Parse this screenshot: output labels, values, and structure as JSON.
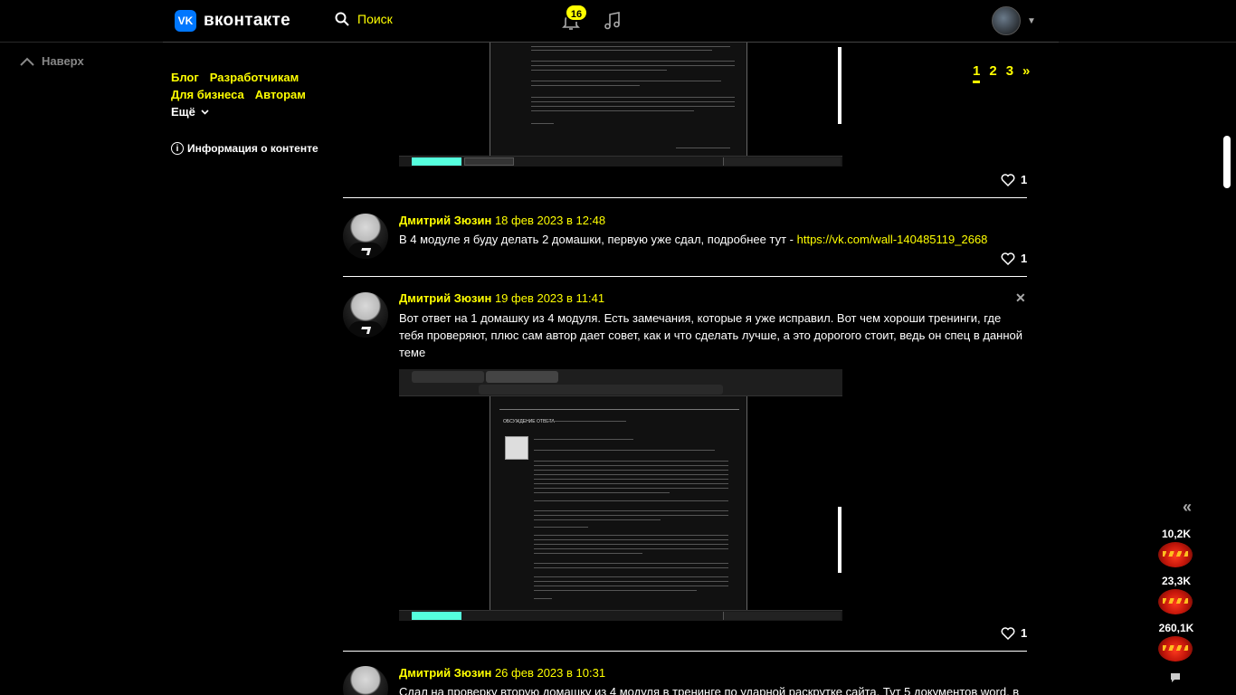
{
  "header": {
    "logo_text": "вконтакте",
    "logo_mark": "VK",
    "search_label": "Поиск",
    "notifications_count": "16"
  },
  "sidebar": {
    "back_to_top": "Наверх",
    "links": [
      "Блог",
      "Разработчикам",
      "Для бизнеса",
      "Авторам"
    ],
    "more": "Ещё",
    "content_info": "Информация о контенте"
  },
  "pagination": {
    "pages": [
      "1",
      "2",
      "3"
    ],
    "current": "1",
    "next": "»"
  },
  "posts": [
    {
      "likes": "1"
    },
    {
      "author": "Дмитрий Зюзин",
      "date": "18 фев 2023 в 12:48",
      "text": "В 4 модуле я буду делать 2 домашки, первую уже сдал, подробнее тут - ",
      "link": "https://vk.com/wall-140485119_2668",
      "likes": "1"
    },
    {
      "author": "Дмитрий Зюзин",
      "date": "19 фев 2023 в 11:41",
      "text": "Вот ответ на 1 домашку из 4 модуля. Есть замечания, которые я уже исправил. Вот чем хороши тренинги, где тебя проверяют, плюс сам автор дает совет, как и что сделать лучше, а это дорогого стоит, ведь он спец в данной теме",
      "likes": "1",
      "shot_heading": "ОБСУЖДЕНИЕ ОТВЕТА"
    },
    {
      "author": "Дмитрий Зюзин",
      "date": "26 фев 2023 в 10:31",
      "text": "Сдал на проверку вторую домашку из 4 модуля в тренинге по ударной раскрутке сайта. Тут 5 документов word, в"
    }
  ],
  "reactions": [
    {
      "count": "10,2K"
    },
    {
      "count": "23,3K"
    },
    {
      "count": "260,1K"
    }
  ],
  "colors": {
    "accent": "#ffff00",
    "background": "#000000",
    "vk_blue": "#0077ff"
  }
}
